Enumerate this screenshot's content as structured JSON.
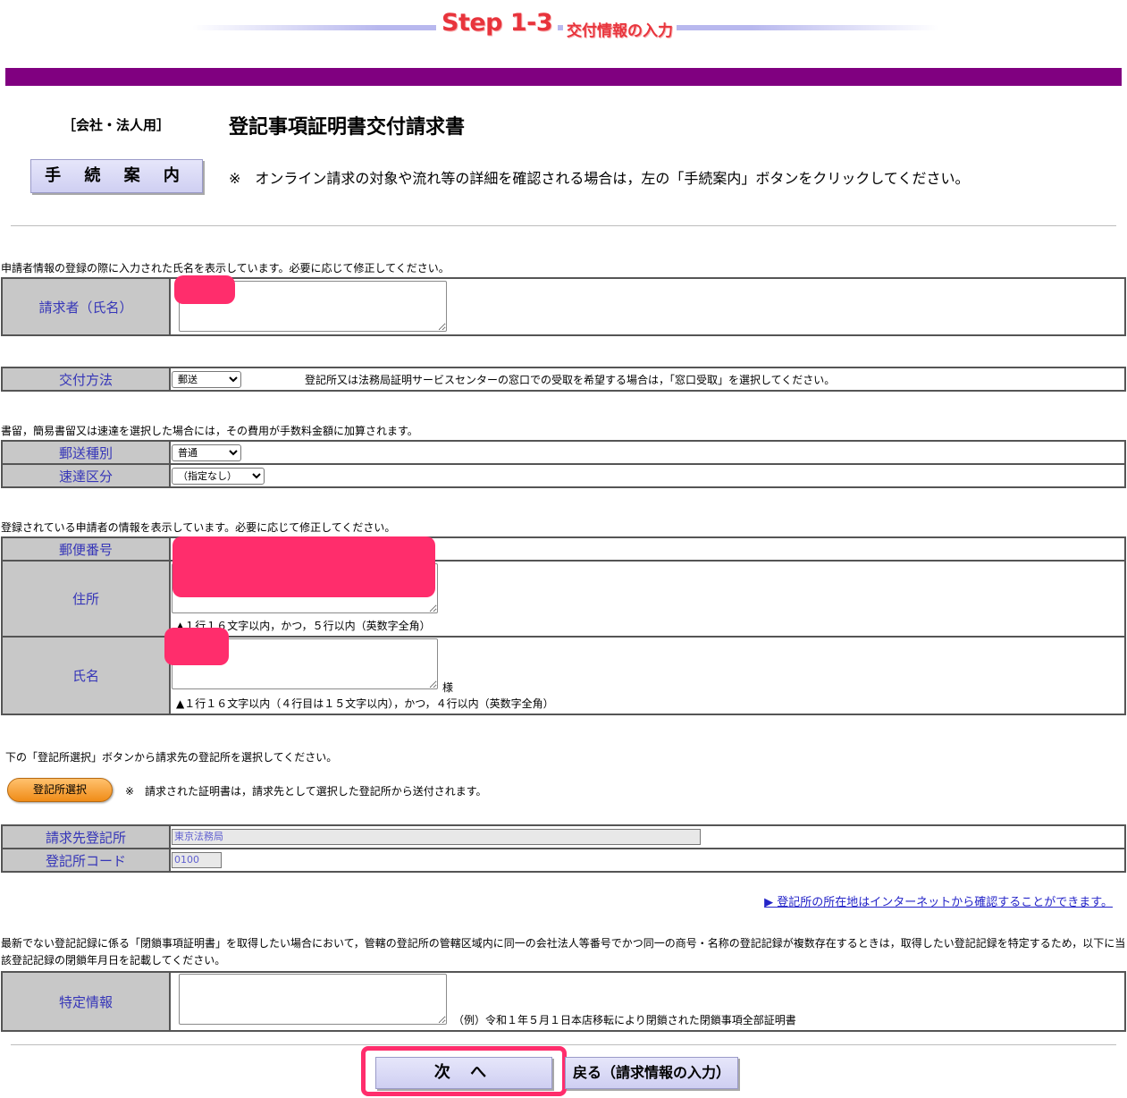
{
  "header": {
    "step": "Step 1-3",
    "step_sub": "交付情報の入力",
    "form_type": "［会社・法人用］",
    "form_title": "登記事項証明書交付請求書",
    "guide_button": "手 続 案 内",
    "guide_note": "※　オンライン請求の対象や流れ等の詳細を確認される場合は，左の「手続案内」ボタンをクリックしてください。"
  },
  "requester": {
    "note": "申請者情報の登録の際に入力された氏名を表示しています。必要に応じて修正してください。",
    "label": "請求者（氏名）"
  },
  "delivery": {
    "label": "交付方法",
    "selected": "郵送",
    "hint": "登記所又は法務局証明サービスセンターの窓口での受取を希望する場合は，「窓口受取」を選択してください。"
  },
  "mail": {
    "note": "書留，簡易書留又は速達を選択した場合には，その費用が手数料金額に加算されます。",
    "type_label": "郵送種別",
    "type_selected": "普通",
    "express_label": "速達区分",
    "express_selected": "（指定なし）"
  },
  "applicant": {
    "note": "登録されている申請者の情報を表示しています。必要に応じて修正してください。",
    "postal_label": "郵便番号",
    "address_label": "住所",
    "address_hint": "▲１行１６文字以内，かつ，５行以内（英数字全角）",
    "name_label": "氏名",
    "name_suffix": "様",
    "name_hint": "▲１行１６文字以内（４行目は１５文字以内），かつ，４行以内（英数字全角）"
  },
  "office": {
    "note": "下の「登記所選択」ボタンから請求先の登記所を選択してください。",
    "select_button": "登記所選択",
    "select_note": "※　請求された証明書は，請求先として選択した登記所から送付されます。",
    "dest_label": "請求先登記所",
    "dest_value": "東京法務局",
    "code_label": "登記所コード",
    "code_value": "0100",
    "link": "▶ 登記所の所在地はインターネットから確認することができます。"
  },
  "specific": {
    "note": "最新でない登記記録に係る「閉鎖事項証明書」を取得したい場合において，管轄の登記所の管轄区域内に同一の会社法人等番号でかつ同一の商号・名称の登記記録が複数存在するときは，取得したい登記記録を特定するため，以下に当該登記記録の閉鎖年月日を記載してください。",
    "label": "特定情報",
    "example": "（例）令和１年５月１日本店移転により閉鎖された閉鎖事項全部証明書"
  },
  "footer": {
    "next_button": "次 へ",
    "back_button": "戻る（請求情報の入力）"
  },
  "colors": {
    "purple_bar": "#800080",
    "step_red": "#e8343c",
    "label_bg": "#c8c8c8",
    "label_text": "#3636b8",
    "redaction": "#ff2d6c"
  }
}
